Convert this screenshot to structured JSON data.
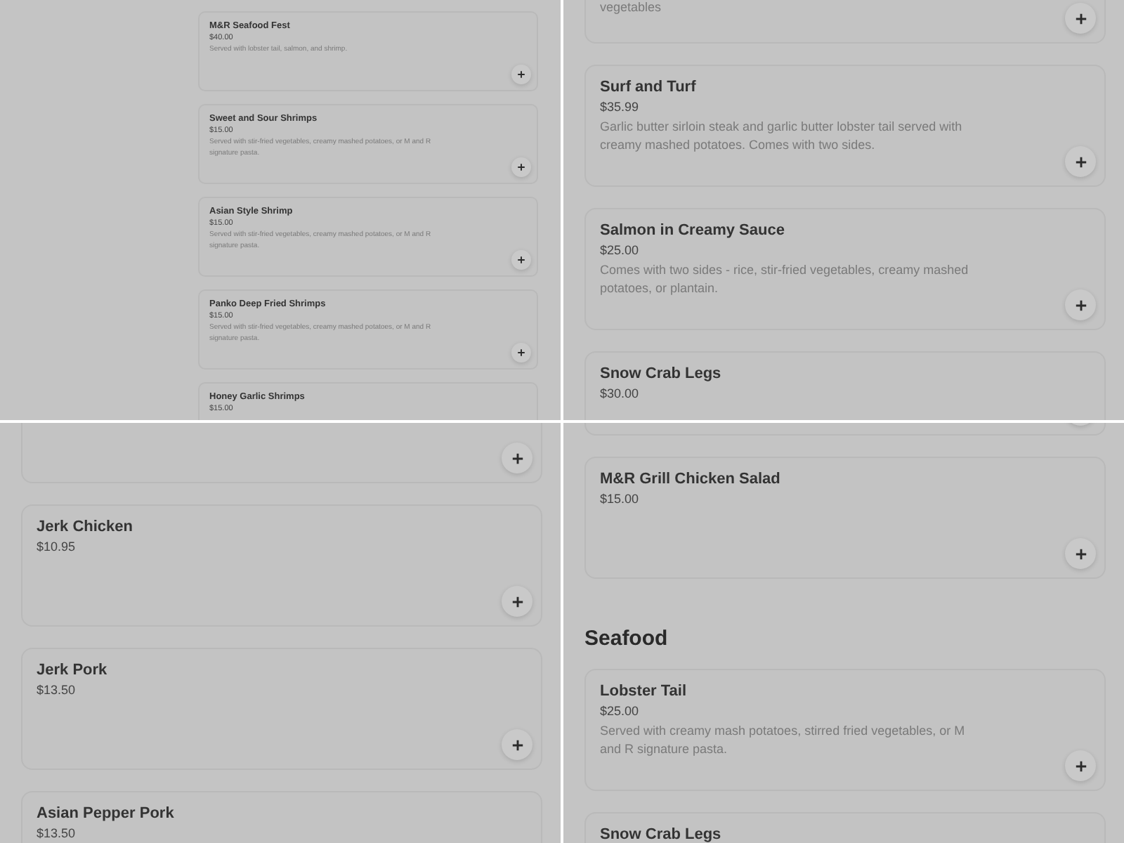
{
  "panels": [
    {
      "items": [
        {
          "kind": "card",
          "name": "M&R Seafood Fest",
          "price": "$40.00",
          "description": "Served with lobster tail, salmon, and shrimp."
        },
        {
          "kind": "card",
          "name": "Sweet and Sour Shrimps",
          "price": "$15.00",
          "description": "Served with stir-fried vegetables, creamy mashed potatoes, or M and R signature pasta."
        },
        {
          "kind": "card",
          "name": "Asian Style Shrimp",
          "price": "$15.00",
          "description": "Served with stir-fried vegetables, creamy mashed potatoes, or M and R signature pasta."
        },
        {
          "kind": "card",
          "name": "Panko Deep Fried Shrimps",
          "price": "$15.00",
          "description": "Served with stir-fried vegetables, creamy mashed potatoes, or M and R signature pasta."
        },
        {
          "kind": "card",
          "name": "Honey Garlic Shrimps",
          "price": "$15.00"
        }
      ]
    },
    {
      "items": [
        {
          "kind": "card",
          "description": "vegetables"
        },
        {
          "kind": "card",
          "name": "Surf and Turf",
          "price": "$35.99",
          "description": "Garlic butter sirloin steak and garlic butter lobster tail served with creamy mashed potatoes. Comes with two sides."
        },
        {
          "kind": "card",
          "name": "Salmon in Creamy Sauce",
          "price": "$25.00",
          "description": "Comes with two sides - rice, stir-fried vegetables, creamy mashed potatoes, or plantain."
        },
        {
          "kind": "card",
          "name": "Snow Crab Legs",
          "price": "$30.00"
        }
      ]
    },
    {
      "items": [
        {
          "kind": "card"
        },
        {
          "kind": "card",
          "name": "Jerk Chicken",
          "price": "$10.95"
        },
        {
          "kind": "card",
          "name": "Jerk Pork",
          "price": "$13.50"
        },
        {
          "kind": "card",
          "name": "Asian Pepper Pork",
          "price": "$13.50"
        }
      ]
    },
    {
      "items": [
        {
          "kind": "card"
        },
        {
          "kind": "card",
          "name": "M&R Grill Chicken Salad",
          "price": "$15.00"
        },
        {
          "kind": "heading",
          "name": "Seafood"
        },
        {
          "kind": "card",
          "name": "Lobster Tail",
          "price": "$25.00",
          "description": "Served with creamy mash potatoes, stirred fried vegetables, or M and R signature pasta."
        },
        {
          "kind": "card",
          "name": "Snow Crab Legs"
        }
      ]
    }
  ]
}
